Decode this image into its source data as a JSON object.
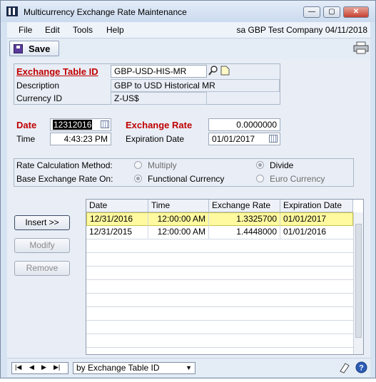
{
  "window": {
    "title": "Multicurrency Exchange Rate Maintenance",
    "minimize_glyph": "—",
    "maximize_glyph": "▢",
    "close_glyph": "✕"
  },
  "menu": {
    "items": [
      "File",
      "Edit",
      "Tools",
      "Help"
    ],
    "status": "sa  GBP Test Company  04/11/2018"
  },
  "toolbar": {
    "save_label": "Save"
  },
  "form": {
    "exchange_table_id_label": "Exchange Table ID",
    "exchange_table_id_value": "GBP-USD-HIS-MR",
    "description_label": "Description",
    "description_value": "GBP to USD Historical MR",
    "currency_id_label": "Currency ID",
    "currency_id_value": "Z-US$",
    "date_label": "Date",
    "date_value": "12312016",
    "time_label": "Time",
    "time_value": "4:43:23 PM",
    "exchange_rate_label": "Exchange Rate",
    "exchange_rate_value": "0.0000000",
    "expiration_date_label": "Expiration Date",
    "expiration_date_value": "01/01/2017"
  },
  "options": {
    "rate_calc_label": "Rate Calculation Method:",
    "multiply_label": "Multiply",
    "divide_label": "Divide",
    "base_rate_label": "Base Exchange Rate On:",
    "functional_label": "Functional Currency",
    "euro_label": "Euro Currency"
  },
  "buttons": {
    "insert": "Insert >>",
    "modify": "Modify",
    "remove": "Remove"
  },
  "grid": {
    "headers": [
      "Date",
      "Time",
      "Exchange Rate",
      "Expiration Date"
    ],
    "rows": [
      [
        "12/31/2016",
        "12:00:00 AM",
        "1.3325700",
        "01/01/2017"
      ],
      [
        "12/31/2015",
        "12:00:00 AM",
        "1.4448000",
        "01/01/2016"
      ]
    ]
  },
  "statusbar": {
    "sort_by": "by Exchange Table ID"
  },
  "colors": {
    "required_label": "#c00000",
    "selected_row": "#fff9a0",
    "window_bg": "#d6e3f3"
  }
}
